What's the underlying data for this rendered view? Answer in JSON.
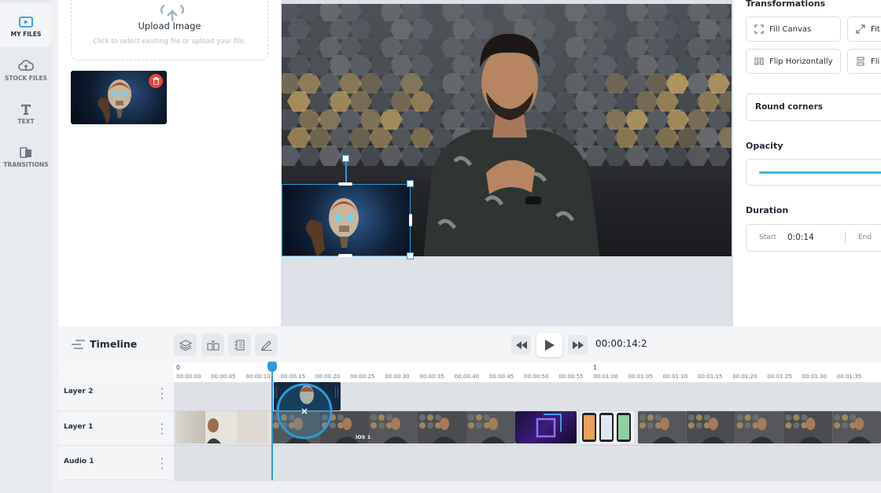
{
  "nav": {
    "items": [
      {
        "label": "MY FILES",
        "icon": "media-folder-icon",
        "active": true
      },
      {
        "label": "STOCK FILES",
        "icon": "cloud-icon",
        "active": false
      },
      {
        "label": "TEXT",
        "icon": "text-t-icon",
        "active": false
      },
      {
        "label": "TRANSITIONS",
        "icon": "transitions-icon",
        "active": false
      }
    ]
  },
  "upload": {
    "title": "Upload Image",
    "subtitle": "Click to select existing file or upload your file."
  },
  "properties": {
    "transformations_title": "Transformations",
    "fill_canvas": "Fill Canvas",
    "fit": "Fit",
    "flip_horizontally": "Flip Horizontally",
    "flip_v": "Fli",
    "round_corners": "Round corners",
    "opacity_title": "Opacity",
    "duration_title": "Duration",
    "duration_start_label": "Start",
    "duration_start_value": "0:0:14",
    "duration_end_label": "End"
  },
  "timeline": {
    "title": "Timeline",
    "timecode": "00:00:14:2",
    "ruler_major": [
      "0",
      "1"
    ],
    "ruler_ticks": [
      "00:00:00",
      "00:00:05",
      "00:00:10",
      "00:00:15",
      "00:00:20",
      "00:00:25",
      "00:00:30",
      "00:00:35",
      "00:00:40",
      "00:00:45",
      "00:00:50",
      "00:00:55",
      "00:01:00",
      "00:01:05",
      "00:01:10",
      "00:01:15",
      "00:01:20",
      "00:01:25",
      "00:01:30",
      "00:01:35"
    ],
    "layers": [
      "Layer 2",
      "Layer 1",
      "Audio 1"
    ],
    "clip_badge": "iOS 1"
  },
  "colors": {
    "accent": "#2e9bd8",
    "delete": "#e8453c",
    "slider": "#38b6e8"
  }
}
